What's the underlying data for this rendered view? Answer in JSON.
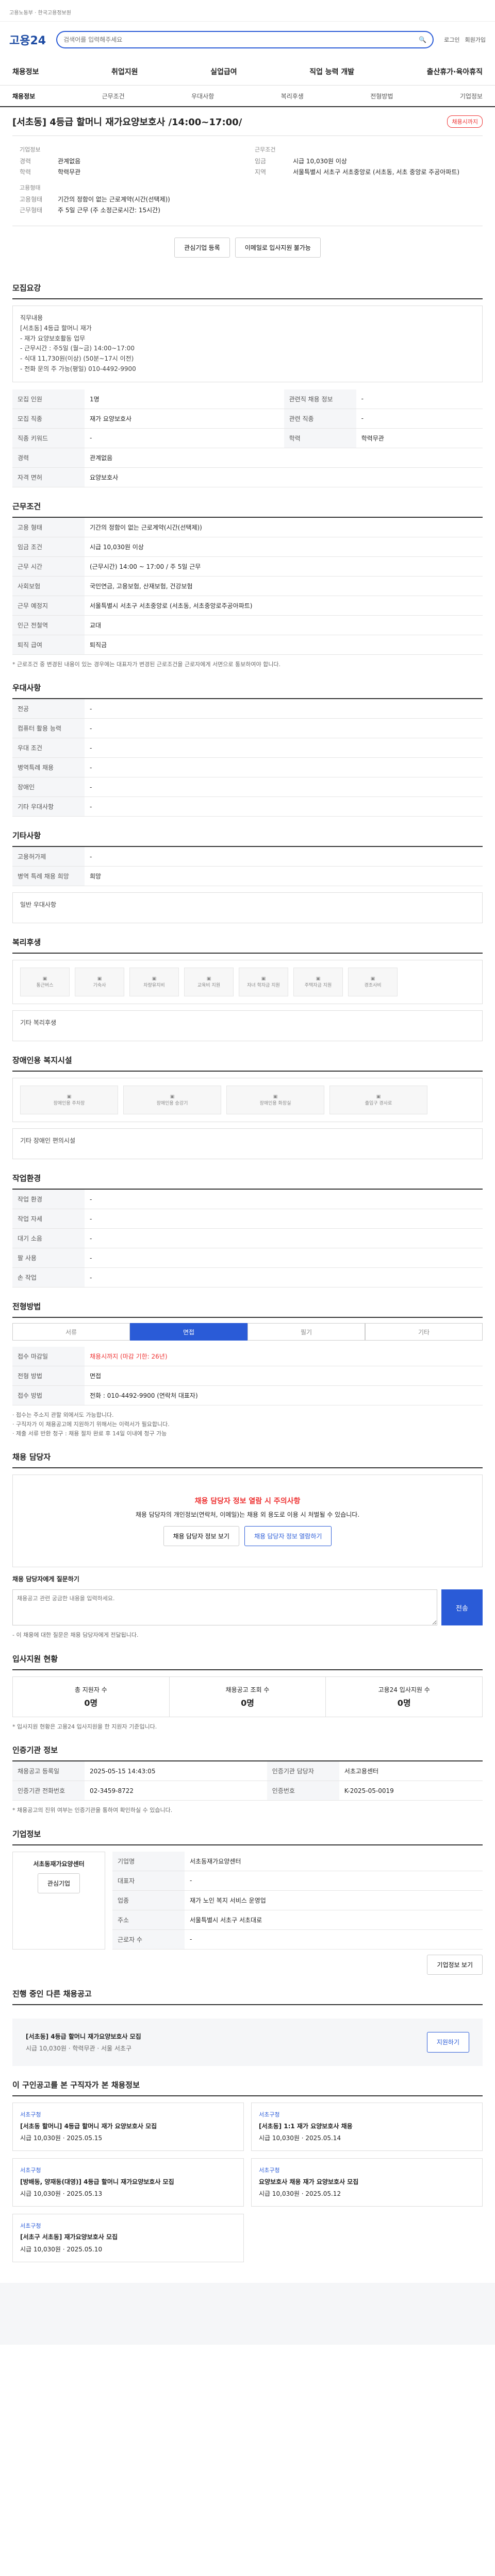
{
  "header": {
    "logo": "고용24",
    "search_placeholder": "검색어를 입력해주세요",
    "links": [
      "로그인",
      "회원가입"
    ]
  },
  "gnb": [
    "채용정보",
    "취업지원",
    "실업급여",
    "직업 능력 개발",
    "출산휴가·육아휴직"
  ],
  "subnav": [
    "채용정보",
    "근무조건",
    "우대사항",
    "복리후생",
    "전형방법",
    "기업정보"
  ],
  "job": {
    "title": "[서초동] 4등급 할머니 재가요양보호사 /14:00~17:00/",
    "status": "채용시까지",
    "company_label": "기업정보",
    "company_rows": [
      {
        "k": "경력",
        "v": "관계없음"
      },
      {
        "k": "학력",
        "v": "학력무관"
      }
    ],
    "cond_label": "근무조건",
    "cond_rows": [
      {
        "k": "임금",
        "v": "시급 10,030원 이상"
      },
      {
        "k": "지역",
        "v": "서울특별시 서초구 서초중앙로 (서초동, 서초 중앙로 주공아파트)"
      }
    ],
    "employ_label": "고용형태",
    "employ_rows": [
      {
        "k": "고용형태",
        "v": "기간의 정함이 없는 근로계약(시간(선택제))"
      },
      {
        "k": "근무형태",
        "v": "주 5일 근무 (주 소정근로시간: 15시간)"
      }
    ]
  },
  "buttons": {
    "interest": "관심기업 등록",
    "scrap": "이메일로 입사지원 불가능"
  },
  "recruit": {
    "title": "모집요강",
    "text": "직무내용\n[서초동] 4등급 할머니 재가\n- 재가 요양보호활동 업무\n- 근무시간 : 주5일 (월~금) 14:00~17:00\n- 식대 11,730원(이상) (50분~17시 이전)\n- 전화 문의 주 가능(평일) 010-4492-9900",
    "rows": [
      {
        "k": "모집 인원",
        "v": "1명"
      },
      {
        "k": "모집 직종",
        "v": "재가 요양보호사"
      },
      {
        "k": "직종 키워드",
        "v": "-"
      },
      {
        "k": "경력",
        "v": "관계없음"
      },
      {
        "k": "자격 면허",
        "v": "요양보호사"
      }
    ],
    "rows_r": [
      {
        "k": "관련직 채용 정보",
        "v": "-"
      },
      {
        "k": "관련 직종",
        "v": "-"
      },
      {
        "k": "학력",
        "v": "학력무관"
      }
    ]
  },
  "conditions": {
    "title": "근무조건",
    "rows": [
      {
        "k": "고용 형태",
        "v": "기간의 정함이 없는 근로계약(시간(선택제))"
      },
      {
        "k": "임금 조건",
        "v": "시급 10,030원 이상"
      },
      {
        "k": "근무 시간",
        "v": "(근무시간) 14:00 ~ 17:00 / 주 5일 근무"
      },
      {
        "k": "사회보험",
        "v": "국민연금, 고용보험, 산재보험, 건강보험"
      },
      {
        "k": "근무 예정지",
        "v": "서울특별시 서초구 서초중앙로 (서초동, 서초중앙로주공아파트)"
      },
      {
        "k": "인근 전철역",
        "v": "교대"
      },
      {
        "k": "퇴직 급여",
        "v": "퇴직금"
      }
    ],
    "note": "* 근로조건 중 변경된 내용이 있는 경우에는 대표자가 변경된 근로조건을 근로자에게 서면으로 통보하여야 합니다."
  },
  "preference": {
    "title": "우대사항",
    "rows": [
      {
        "k": "전공",
        "v": "-"
      },
      {
        "k": "컴퓨터 활용 능력",
        "v": "-"
      },
      {
        "k": "우대 조건",
        "v": "-"
      },
      {
        "k": "병역특례 채용",
        "v": "-"
      },
      {
        "k": "장애인",
        "v": "-"
      },
      {
        "k": "기타 우대사항",
        "v": "-"
      }
    ]
  },
  "etc": {
    "title": "기타사항",
    "rows": [
      {
        "k": "고용허가제",
        "v": "-"
      },
      {
        "k": "병역 특례 채용 희망",
        "v": "희망"
      }
    ],
    "note_label": "일반 우대사항"
  },
  "welfare": {
    "title": "복리후생",
    "items": [
      "통근버스",
      "기숙사",
      "차량유지비",
      "교육비 지원",
      "자녀 학자금 지원",
      "주택자금 지원",
      "경조사비"
    ],
    "other_label": "기타 복리후생"
  },
  "disability": {
    "title": "장애인용 복지시설",
    "items": [
      "장애인용 주차장",
      "장애인용 승강기",
      "장애인용 화장실",
      "출입구 경사로"
    ],
    "other_label": "기타 장애인 편의시설"
  },
  "workenv": {
    "title": "작업환경",
    "rows": [
      {
        "k": "작업 환경",
        "v": "-"
      },
      {
        "k": "작업 자세",
        "v": "-"
      },
      {
        "k": "대기 소음",
        "v": "-"
      },
      {
        "k": "팔 사용",
        "v": "-"
      },
      {
        "k": "손 작업",
        "v": "-"
      }
    ]
  },
  "selection": {
    "title": "전형방법",
    "steps": [
      "서류",
      "면접",
      "필기",
      "기타"
    ],
    "rows": [
      {
        "k": "접수 마감일",
        "v": "채용시까지 (마감 기한: 26년)"
      },
      {
        "k": "전형 방법",
        "v": "면접"
      },
      {
        "k": "접수 방법",
        "v": "전화 : 010-4492-9900 (연락처 대표자)"
      }
    ],
    "notes": "· 접수는 주소지 관할 외에서도 가능합니다.\n· 구직자가 이 채용공고에 지원하기 위해서는 이력서가 필요합니다.\n· 제출 서류 반환 청구 : 채용 절차 완료 후 14일 이내에 청구 가능"
  },
  "contact": {
    "title": "채용 담당자",
    "alert_title": "채용 담당자 정보 열람 시 주의사항",
    "alert_text": "채용 담당자의 개인정보(연락처, 이메일)는 채용 외 용도로 이용 시 처벌될 수 있습니다.",
    "btn1": "채용 담당자 정보 보기",
    "btn2": "채용 담당자 정보 열람하기",
    "inquiry_title": "채용 담당자에게 질문하기",
    "inquiry_placeholder": "채용공고 관련 궁금한 내용을 입력하세요.",
    "inquiry_btn": "전송",
    "notes": "- 이 채용에 대한 질문은 채용 담당자에게 전달됩니다."
  },
  "counts": {
    "title": "입사지원 현황",
    "items": [
      {
        "label": "총 지원자 수",
        "value": "0명"
      },
      {
        "label": "채용공고 조회 수",
        "value": "0명"
      },
      {
        "label": "고용24 입사지원 수",
        "value": "0명"
      }
    ],
    "note": "* 입사지원 현황은 고용24 입사지원을 한 지원자 기준입니다."
  },
  "org": {
    "title": "인증기관 정보",
    "rows": [
      {
        "k": "채용공고 등록일",
        "v": "2025-05-15 14:43:05"
      },
      {
        "k": "인증기관 담당자",
        "v": "서초고용센터"
      },
      {
        "k": "인증기관 전화번호",
        "v": "02-3459-8722"
      },
      {
        "k": "인증번호",
        "v": "K-2025-05-0019"
      }
    ],
    "notes": "* 채용공고의 진위 여부는 인증기관을 통하여 확인하실 수 있습니다."
  },
  "company": {
    "title": "기업정보",
    "name": "서초동재가요양센터",
    "rows": [
      {
        "k": "기업명",
        "v": "서초동재가요양센터"
      },
      {
        "k": "대표자",
        "v": "-"
      },
      {
        "k": "업종",
        "v": "재가 노인 복지 서비스 운영업"
      },
      {
        "k": "주소",
        "v": "서울특별시 서초구 서초대로"
      },
      {
        "k": "근로자 수",
        "v": "-"
      }
    ],
    "btn_interest": "관심기업",
    "btn_other": "기업정보 보기"
  },
  "other_jobs": {
    "title": "진행 중인 다른 채용공고",
    "item_title": "[서초동] 4등급 할머니 재가요양보호사 모집",
    "item_meta": "시급 10,030원 · 학력무관 · 서울 서초구",
    "btn": "지원하기"
  },
  "recommend": {
    "title": "이 구인공고를 본 구직자가 본 채용정보",
    "cards": [
      {
        "tag": "서초구청",
        "title": "[서초동 할머니] 4등급 할머니 재가 요양보호사 모집",
        "meta": "시급 10,030원 · 2025.05.15"
      },
      {
        "tag": "서초구청",
        "title": "[서초동] 1:1 재가 요양보호사 채용",
        "meta": "시급 10,030원 · 2025.05.14"
      },
      {
        "tag": "서초구청",
        "title": "[방배동, 양재동(대영)] 4등급 할머니 재가요양보호사 모집",
        "meta": "시급 10,030원 · 2025.05.13"
      },
      {
        "tag": "서초구청",
        "title": "요양보호사 채용 재가 요양보호사 모집",
        "meta": "시급 10,030원 · 2025.05.12"
      },
      {
        "tag": "서초구청",
        "title": "[서초구 서초동] 재가요양보호사 모집",
        "meta": "시급 10,030원 · 2025.05.10"
      }
    ]
  }
}
